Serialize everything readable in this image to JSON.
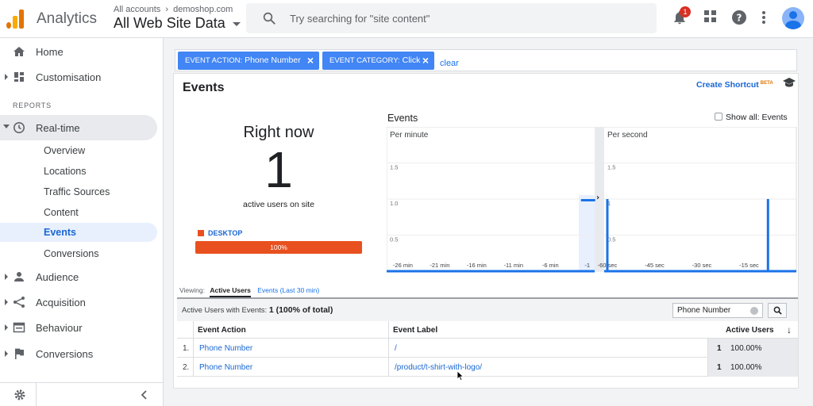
{
  "app": {
    "title": "Analytics",
    "account_crumb_account": "All accounts",
    "account_crumb_property": "demoshop.com",
    "property_name": "All Web Site Data",
    "search_placeholder": "Try searching for \"site content\"",
    "notification_count": "1"
  },
  "sidebar": {
    "items": [
      {
        "label": "Home",
        "icon": "home-icon"
      },
      {
        "label": "Customisation",
        "icon": "dashboard-icon"
      }
    ],
    "section_label": "REPORTS",
    "realtime": {
      "label": "Real-time",
      "icon": "clock-icon",
      "subitems": [
        "Overview",
        "Locations",
        "Traffic Sources",
        "Content",
        "Events",
        "Conversions"
      ],
      "selected": "Events"
    },
    "groups": [
      {
        "label": "Audience",
        "icon": "person-icon"
      },
      {
        "label": "Acquisition",
        "icon": "acquisition-icon"
      },
      {
        "label": "Behaviour",
        "icon": "behaviour-icon"
      },
      {
        "label": "Conversions",
        "icon": "flag-icon"
      }
    ]
  },
  "filters": {
    "chips": [
      {
        "key": "EVENT ACTION:",
        "value": "Phone Number"
      },
      {
        "key": "EVENT CATEGORY:",
        "value": "Click"
      }
    ],
    "clear_label": "clear"
  },
  "report": {
    "title": "Events",
    "shortcut_label": "Create Shortcut",
    "shortcut_badge": "BETA",
    "right_now_label": "Right now",
    "active_users": "1",
    "active_users_label": "active users on site",
    "device_label": "DESKTOP",
    "device_percent": 100,
    "device_percent_label": "100%",
    "device_color": "#e8511f",
    "chart_title": "Events",
    "show_all_label": "Show all: Events"
  },
  "chart_data": [
    {
      "type": "bar",
      "title": "Per minute",
      "x_tick_labels": [
        "-26 min",
        "-21 min",
        "-16 min",
        "-11 min",
        "-6 min",
        "-1"
      ],
      "y_tick_labels": [
        "1.5",
        "1.0",
        "0.5"
      ],
      "ylim": [
        0,
        2
      ],
      "bars": [
        {
          "x": -1,
          "value": 1
        }
      ],
      "grid": true,
      "color": "#1a73e8"
    },
    {
      "type": "bar",
      "title": "Per second",
      "x_tick_labels": [
        "-60 sec",
        "-45 sec",
        "-30 sec",
        "-15 sec"
      ],
      "y_tick_labels": [
        "1.5",
        "1",
        "0.5"
      ],
      "ylim": [
        0,
        2
      ],
      "bars": [
        {
          "x": -60,
          "value": 1
        },
        {
          "x": -9,
          "value": 1
        }
      ],
      "grid": true,
      "color": "#1a73e8"
    }
  ],
  "table": {
    "viewing_label": "Viewing:",
    "tab_active": "Active Users",
    "tab_events": "Events (Last 30 min)",
    "summary_label": "Active Users with Events:",
    "summary_value": "1 (100% of total)",
    "search_value": "Phone Number",
    "headers": {
      "action": "Event Action",
      "label": "Event Label",
      "users": "Active Users"
    },
    "rows": [
      {
        "num": "1.",
        "action": "Phone Number",
        "label": "/",
        "users": "1",
        "pct": "100.00%"
      },
      {
        "num": "2.",
        "action": "Phone Number",
        "label": "/product/t-shirt-with-logo/",
        "users": "1",
        "pct": "100.00%"
      }
    ]
  }
}
